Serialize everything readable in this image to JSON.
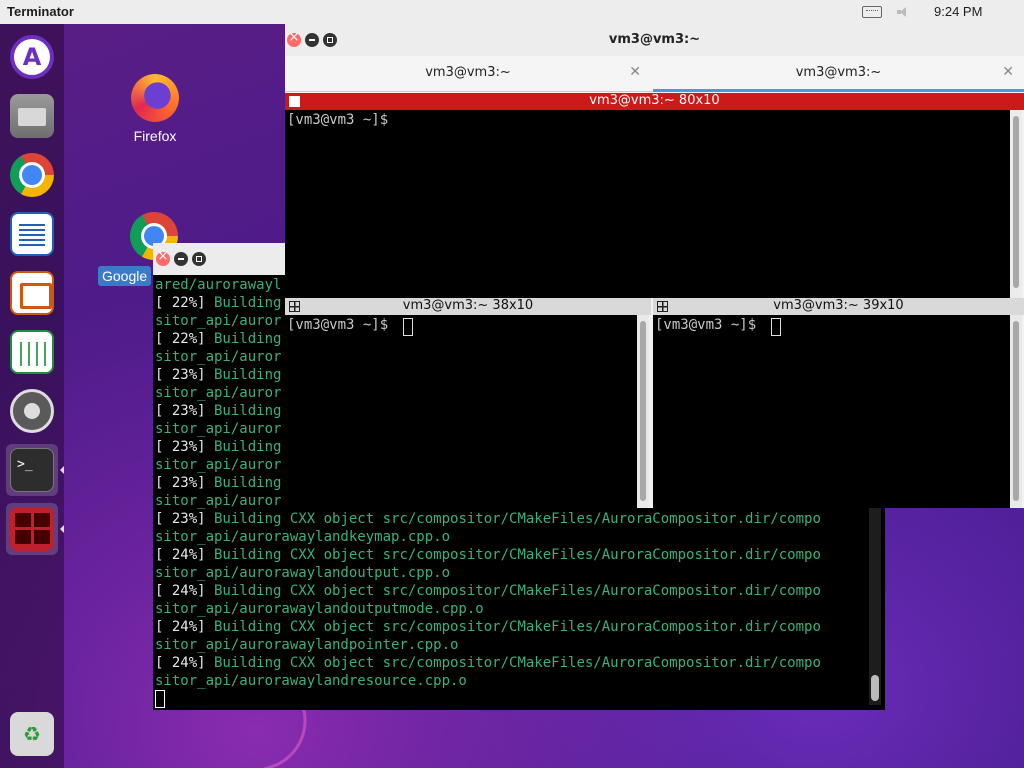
{
  "topbar": {
    "app_name": "Terminator",
    "clock": "9:24 PM",
    "tray_icons": [
      "keyboard-icon",
      "volume-icon"
    ]
  },
  "dock": {
    "items": [
      {
        "name": "Aurora",
        "icon": "aurora-icon",
        "running": false
      },
      {
        "name": "Files",
        "icon": "folder-icon",
        "running": false
      },
      {
        "name": "Google Chrome",
        "icon": "chrome-icon",
        "running": false
      },
      {
        "name": "LibreOffice Writer",
        "icon": "writer-icon",
        "running": false
      },
      {
        "name": "LibreOffice Impress",
        "icon": "impress-icon",
        "running": false
      },
      {
        "name": "LibreOffice Calc",
        "icon": "calc-icon",
        "running": false
      },
      {
        "name": "Settings",
        "icon": "settings-icon",
        "running": false
      },
      {
        "name": "Terminal",
        "icon": "terminal-icon",
        "running": true
      },
      {
        "name": "Terminator",
        "icon": "terminator-icon",
        "running": true
      },
      {
        "name": "Trash",
        "icon": "trash-icon",
        "running": false
      }
    ]
  },
  "desktop": {
    "icons": [
      {
        "label": "Firefox",
        "icon": "firefox-icon"
      },
      {
        "label": "Google",
        "icon": "chrome-icon",
        "selected": true
      }
    ]
  },
  "build_terminal": {
    "lines": [
      {
        "pct": "",
        "text": "ared/aurorawayl"
      },
      {
        "pct": "[ 22%]",
        "text": " Building"
      },
      {
        "pct": "",
        "text": "sitor_api/auror"
      },
      {
        "pct": "[ 22%]",
        "text": " Building"
      },
      {
        "pct": "",
        "text": "sitor_api/auror"
      },
      {
        "pct": "[ 23%]",
        "text": " Building"
      },
      {
        "pct": "",
        "text": "sitor_api/auror"
      },
      {
        "pct": "[ 23%]",
        "text": " Building"
      },
      {
        "pct": "",
        "text": "sitor_api/auror"
      },
      {
        "pct": "[ 23%]",
        "text": " Building"
      },
      {
        "pct": "",
        "text": "sitor_api/auror"
      },
      {
        "pct": "[ 23%]",
        "text": " Building"
      },
      {
        "pct": "",
        "text": "sitor_api/auror"
      },
      {
        "pct": "[ 23%]",
        "text": " Building CXX object src/compositor/CMakeFiles/AuroraCompositor.dir/compo"
      },
      {
        "pct": "",
        "text": "sitor_api/aurorawaylandkeymap.cpp.o"
      },
      {
        "pct": "[ 24%]",
        "text": " Building CXX object src/compositor/CMakeFiles/AuroraCompositor.dir/compo"
      },
      {
        "pct": "",
        "text": "sitor_api/aurorawaylandoutput.cpp.o"
      },
      {
        "pct": "[ 24%]",
        "text": " Building CXX object src/compositor/CMakeFiles/AuroraCompositor.dir/compo"
      },
      {
        "pct": "",
        "text": "sitor_api/aurorawaylandoutputmode.cpp.o"
      },
      {
        "pct": "[ 24%]",
        "text": " Building CXX object src/compositor/CMakeFiles/AuroraCompositor.dir/compo"
      },
      {
        "pct": "",
        "text": "sitor_api/aurorawaylandpointer.cpp.o"
      },
      {
        "pct": "[ 24%]",
        "text": " Building CXX object src/compositor/CMakeFiles/AuroraCompositor.dir/compo"
      },
      {
        "pct": "",
        "text": "sitor_api/aurorawaylandresource.cpp.o"
      }
    ]
  },
  "terminator": {
    "window_title": "vm3@vm3:~",
    "tabs": [
      {
        "label": "vm3@vm3:~",
        "active": false
      },
      {
        "label": "vm3@vm3:~",
        "active": true
      }
    ],
    "panes": [
      {
        "title": "vm3@vm3:~ 80x10",
        "prompt": "[vm3@vm3 ~]$",
        "focused": true
      },
      {
        "title": "vm3@vm3:~ 38x10",
        "prompt": "[vm3@vm3 ~]$",
        "focused": false
      },
      {
        "title": "vm3@vm3:~ 39x10",
        "prompt": "[vm3@vm3 ~]$",
        "focused": false
      }
    ]
  },
  "colors": {
    "focused_pane_header": "#cc1a1a",
    "build_text": "#3cb07a",
    "tab_underline": "#4a9bd4"
  }
}
